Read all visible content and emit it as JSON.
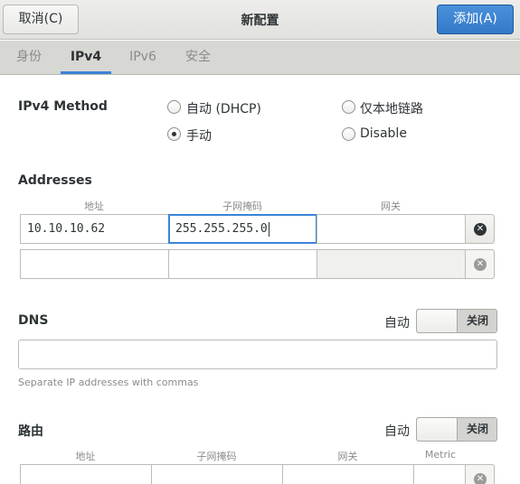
{
  "header": {
    "cancel_label": "取消(C)",
    "title": "新配置",
    "apply_label": "添加(A)"
  },
  "tabs": [
    {
      "label": "身份",
      "active": false
    },
    {
      "label": "IPv4",
      "active": true
    },
    {
      "label": "IPv6",
      "active": false
    },
    {
      "label": "安全",
      "active": false
    }
  ],
  "ipv4_method": {
    "label": "IPv4 Method",
    "options": [
      {
        "label": "自动 (DHCP)",
        "checked": false
      },
      {
        "label": "仅本地链路",
        "checked": false
      },
      {
        "label": "手动",
        "checked": true
      },
      {
        "label": "Disable",
        "checked": false
      }
    ]
  },
  "addresses": {
    "label": "Addresses",
    "columns": [
      "地址",
      "子网掩码",
      "网关"
    ],
    "rows": [
      {
        "address": "10.10.10.62",
        "netmask": "255.255.255.0",
        "gateway": ""
      },
      {
        "address": "",
        "netmask": "",
        "gateway": ""
      }
    ]
  },
  "dns": {
    "label": "DNS",
    "auto_label": "自动",
    "switch_state": "关闭",
    "value": "",
    "hint": "Separate IP addresses with commas"
  },
  "routes": {
    "label": "路由",
    "auto_label": "自动",
    "switch_state": "关闭",
    "columns": [
      "地址",
      "子网掩码",
      "网关",
      "Metric"
    ]
  },
  "colors": {
    "accent": "#3b84d8",
    "apply_button": "#3479c9"
  }
}
